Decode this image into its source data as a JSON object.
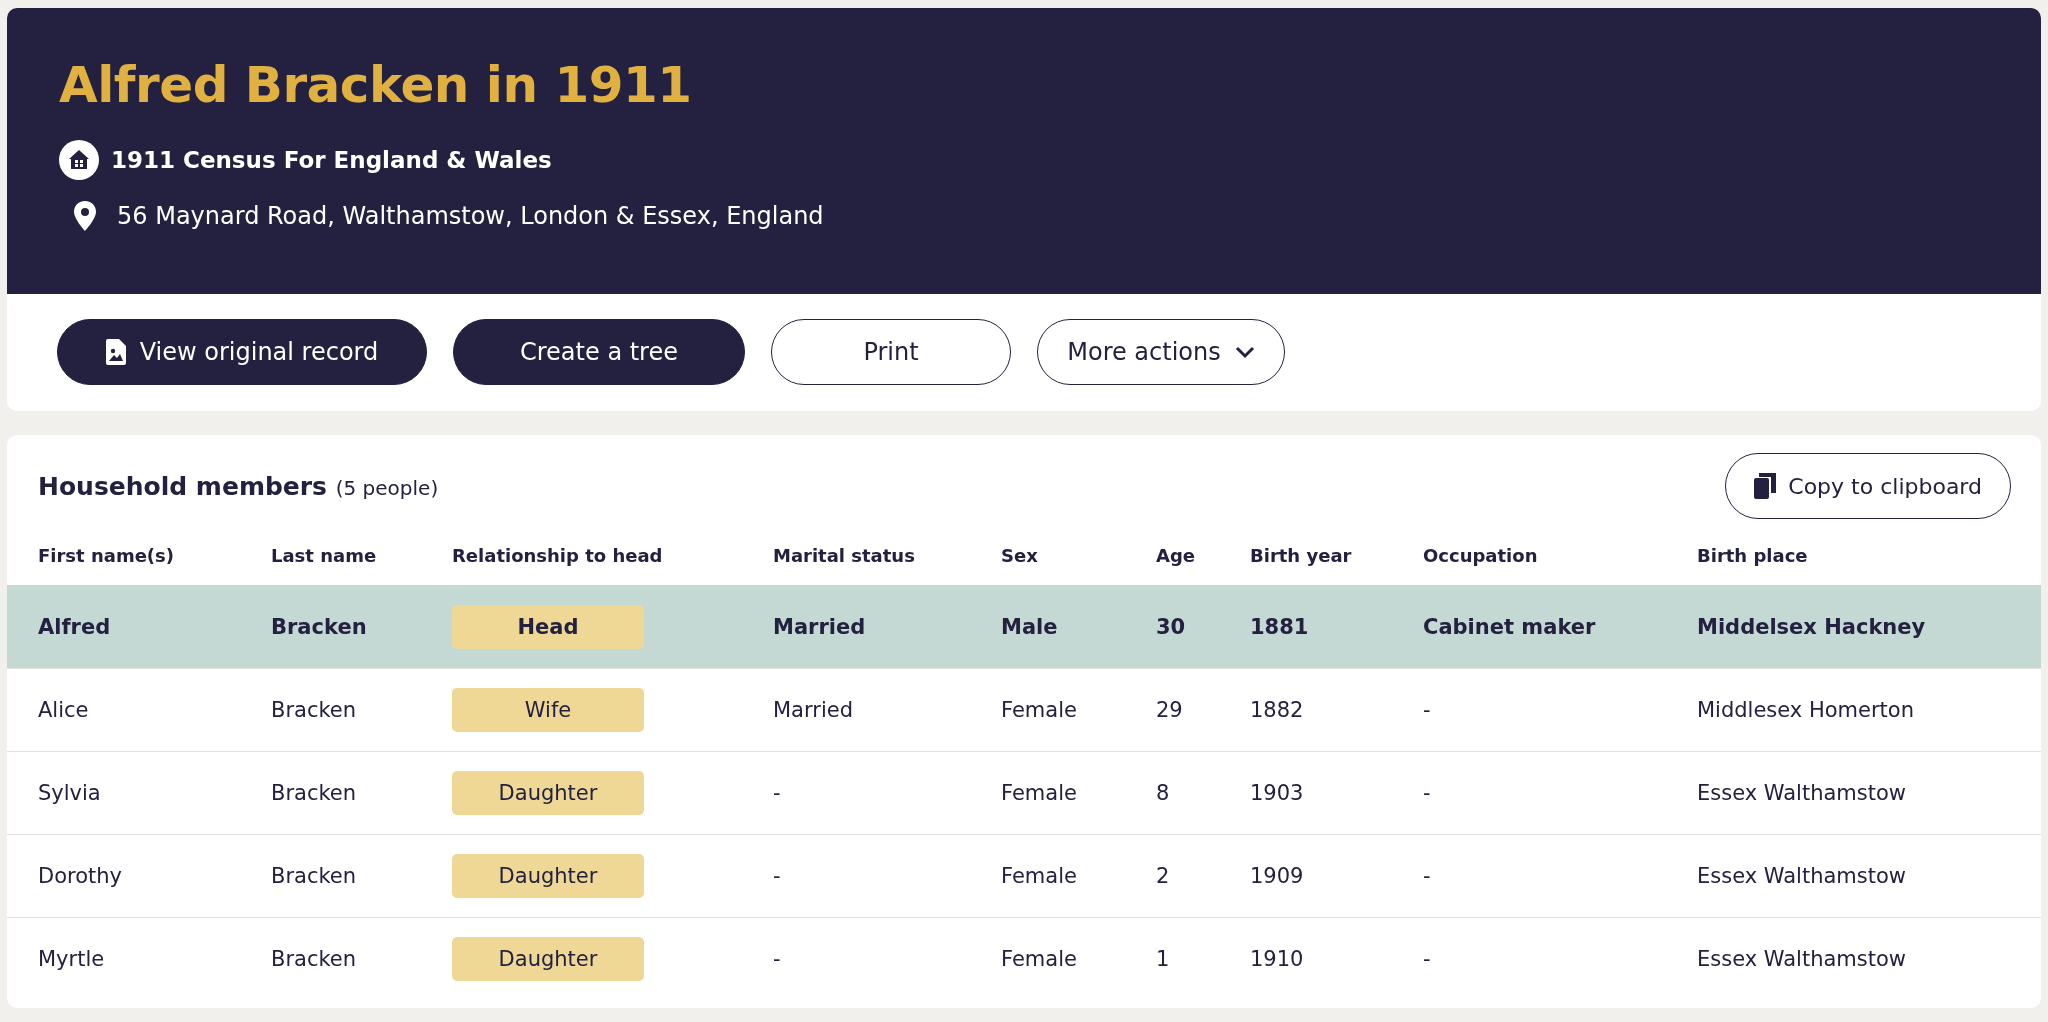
{
  "record": {
    "title": "Alfred Bracken in 1911",
    "collection": "1911 Census For England & Wales",
    "address": "56 Maynard Road, Walthamstow, London & Essex, England"
  },
  "actions": [
    {
      "label": "View original record",
      "kind": "primary-icon"
    },
    {
      "label": "Create a tree",
      "kind": "primary"
    },
    {
      "label": "Print",
      "kind": "outline"
    },
    {
      "label": "More actions",
      "kind": "dropdown"
    }
  ],
  "household": {
    "title": "Household members",
    "count": "(5 people)",
    "copy_button": "Copy to clipboard",
    "columns": [
      "First name(s)",
      "Last name",
      "Relationship to head",
      "Marital status",
      "Sex",
      "Age",
      "Birth year",
      "Occupation",
      "Birth place"
    ],
    "rows": [
      {
        "selected": true,
        "cells": [
          "Alfred",
          "Bracken",
          "Head",
          "Married",
          "Male",
          "30",
          "1881",
          "Cabinet maker",
          "Middelsex Hackney"
        ]
      },
      {
        "selected": false,
        "cells": [
          "Alice",
          "Bracken",
          "Wife",
          "Married",
          "Female",
          "29",
          "1882",
          "-",
          "Middlesex Homerton"
        ]
      },
      {
        "selected": false,
        "cells": [
          "Sylvia",
          "Bracken",
          "Daughter",
          "-",
          "Female",
          "8",
          "1903",
          "-",
          "Essex Walthamstow"
        ]
      },
      {
        "selected": false,
        "cells": [
          "Dorothy",
          "Bracken",
          "Daughter",
          "-",
          "Female",
          "2",
          "1909",
          "-",
          "Essex Walthamstow"
        ]
      },
      {
        "selected": false,
        "cells": [
          "Myrtle",
          "Bracken",
          "Daughter",
          "-",
          "Female",
          "1",
          "1910",
          "-",
          "Essex Walthamstow"
        ]
      }
    ]
  }
}
